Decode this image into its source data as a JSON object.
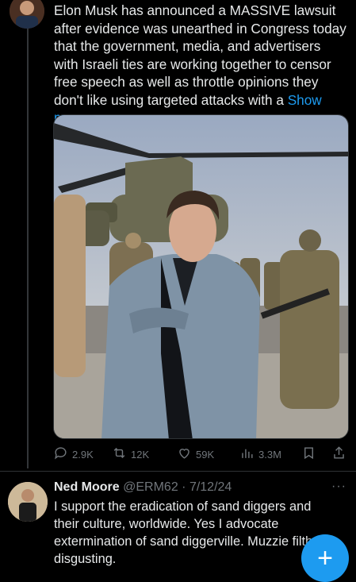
{
  "tweet": {
    "text": "Elon Musk has announced a MASSIVE lawsuit after evidence was unearthed in Congress today that the government, media, and advertisers with Israeli ties are working together to censor free speech as well as throttle opinions they don't like using targeted attacks with a ",
    "show_more": "Show more",
    "stats": {
      "replies": "2.9K",
      "retweets": "12K",
      "likes": "59K",
      "views": "3.3M"
    }
  },
  "reply": {
    "name": "Ned Moore",
    "handle": "@ERM62",
    "separator": " · ",
    "date": "7/12/24",
    "more_label": "···",
    "text": "I support the eradication of sand diggers and their culture, worldwide. Yes I advocate extermination of sand diggerville. Muzzie filth disgusting."
  },
  "compose_button_label": "+",
  "colors": {
    "background": "#000000",
    "text": "#e7e9ea",
    "muted": "#71767b",
    "accent": "#1d9bf0",
    "divider": "#2f3336"
  },
  "icons": [
    "reply-icon",
    "retweet-icon",
    "like-icon",
    "views-icon",
    "bookmark-icon",
    "share-icon",
    "compose-icon"
  ]
}
